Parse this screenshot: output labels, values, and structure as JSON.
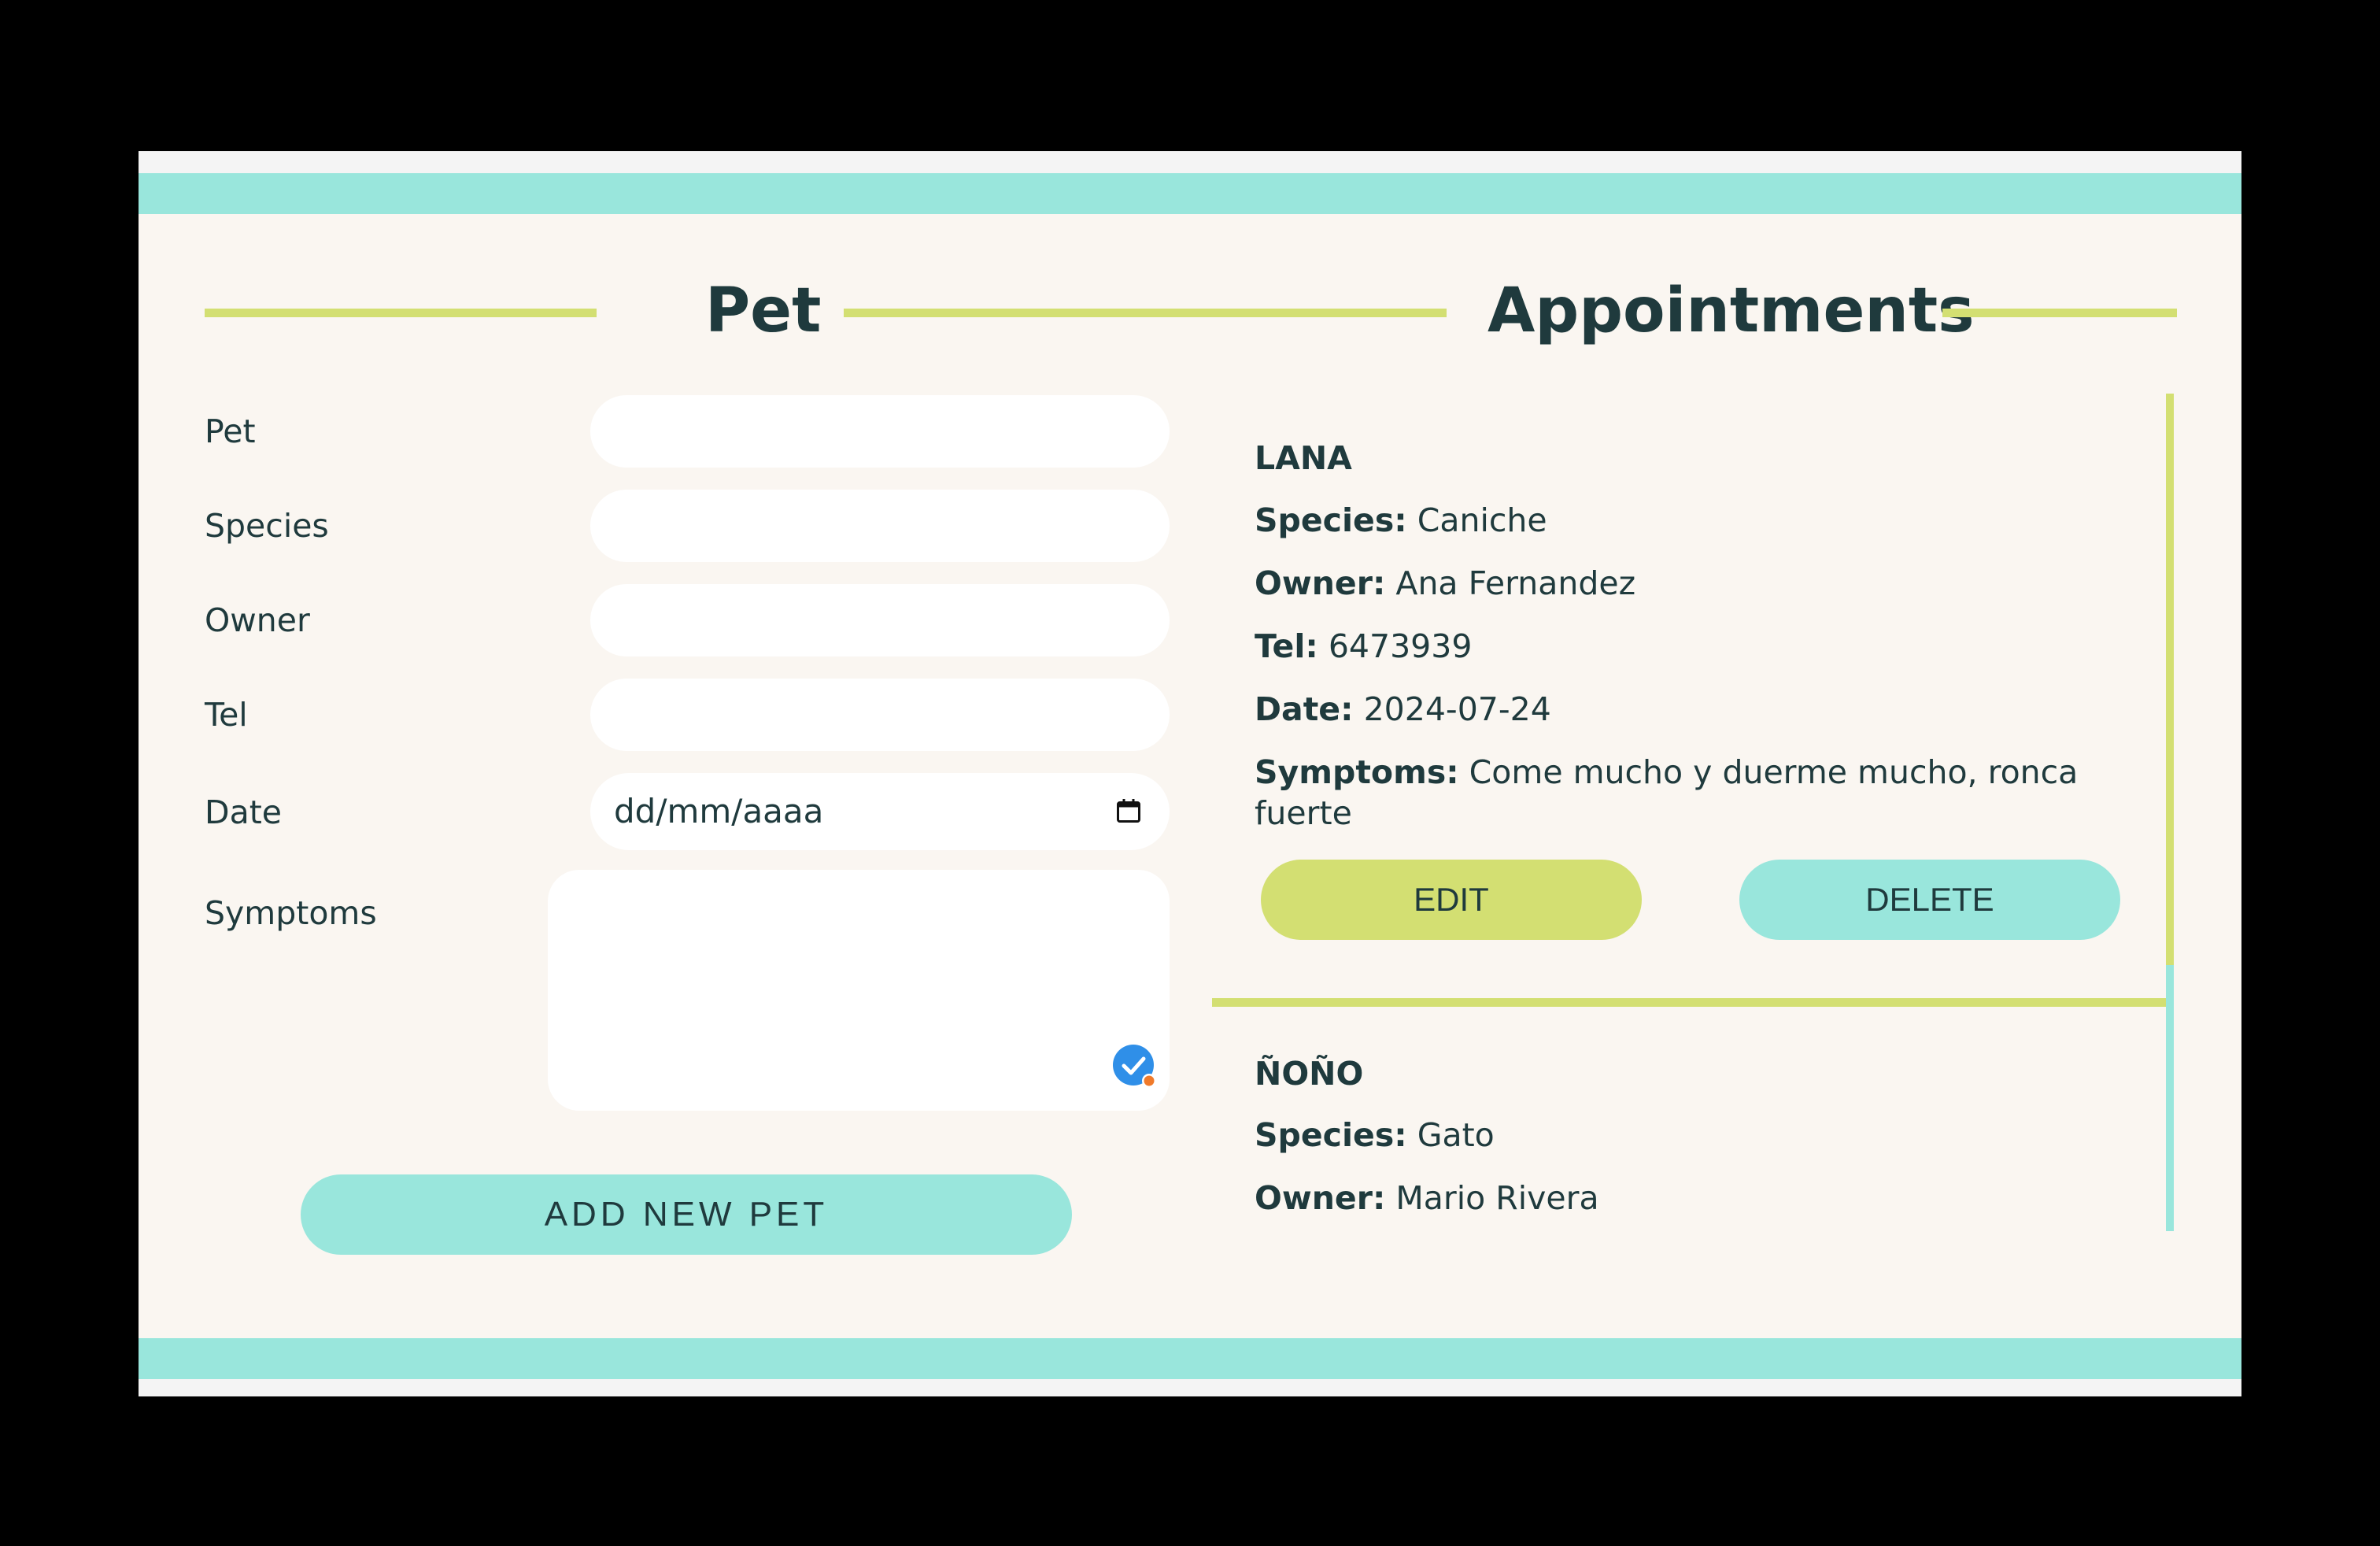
{
  "form": {
    "heading": "Pet",
    "labels": {
      "pet": "Pet",
      "species": "Species",
      "owner": "Owner",
      "tel": "Tel",
      "date": "Date",
      "symptoms": "Symptoms"
    },
    "date_placeholder": "dd/mm/aaaa",
    "submit_label": "ADD NEW PET"
  },
  "appointments": {
    "heading": "Appointments",
    "field_labels": {
      "species": "Species:",
      "owner": "Owner:",
      "tel": "Tel:",
      "date": "Date:",
      "symptoms": "Symptoms:"
    },
    "edit_label": "EDIT",
    "delete_label": "DELETE",
    "items": [
      {
        "name": "LANA",
        "species": "Caniche",
        "owner": "Ana Fernandez",
        "tel": "6473939",
        "date": "2024-07-24",
        "symptoms": "Come mucho y duerme mucho, ronca fuerte"
      },
      {
        "name": "ÑOÑO",
        "species": "Gato",
        "owner": "Mario Rivera"
      }
    ]
  },
  "colors": {
    "accent_teal": "#99e6dc",
    "accent_lime": "#d3df72",
    "background": "#faf6f1",
    "text": "#1f3a3d"
  },
  "icons": [
    "calendar-icon",
    "grammar-check-icon"
  ]
}
